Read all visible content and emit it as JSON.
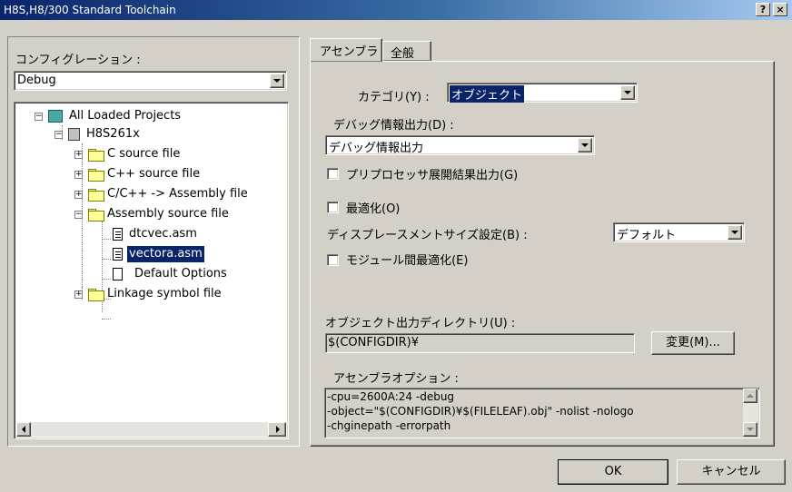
{
  "window": {
    "title": "H8S,H8/300 Standard Toolchain",
    "help_btn": "?",
    "close_btn": "×"
  },
  "left": {
    "config_label": "コンフィグレーション :",
    "config_value": "Debug",
    "tree": [
      {
        "label": "All Loaded Projects",
        "icon": "project-group-icon",
        "expander": "−"
      },
      {
        "label": "H8S261x",
        "icon": "project-icon",
        "expander": "−"
      },
      {
        "label": "C source file",
        "icon": "folder-icon",
        "expander": "+"
      },
      {
        "label": "C++ source file",
        "icon": "folder-icon",
        "expander": "+"
      },
      {
        "label": "C/C++ -> Assembly file",
        "icon": "folder-icon",
        "expander": "+"
      },
      {
        "label": "Assembly source file",
        "icon": "folder-open-icon",
        "expander": "−"
      },
      {
        "label": "dtcvec.asm",
        "icon": "document-icon"
      },
      {
        "label": "vectora.asm",
        "icon": "document-icon",
        "selected": true
      },
      {
        "label": "Default Options",
        "icon": "blank-document-icon"
      },
      {
        "label": "Linkage symbol file",
        "icon": "folder-icon",
        "expander": "+"
      }
    ]
  },
  "tabs": [
    {
      "label": "アセンブラ",
      "active": true
    },
    {
      "label": "全般",
      "active": false
    }
  ],
  "assembler": {
    "category_label": "カテゴリ(Y) :",
    "category_value": "オブジェクト",
    "debug_label": "デバッグ情報出力(D) :",
    "debug_value": "デバッグ情報出力",
    "preprocessor_label": "プリプロセッサ展開結果出力(G)",
    "optimize_label": "最適化(O)",
    "displacement_label": "ディスプレースメントサイズ設定(B) :",
    "displacement_value": "デフォルト",
    "intermodule_label": "モジュール間最適化(E)",
    "outdir_label": "オブジェクト出力ディレクトリ(U) :",
    "outdir_value": "$(CONFIGDIR)¥",
    "change_button": "変更(M)...",
    "options_label": "アセンブラオプション :",
    "options_lines": [
      "-cpu=2600A:24 -debug",
      "-object=\"$(CONFIGDIR)¥$(FILELEAF).obj\" -nolist -nologo",
      "-chginepath -errorpath"
    ]
  },
  "footer": {
    "ok": "OK",
    "cancel": "キャンセル"
  },
  "colors": {
    "face": "#d4d0c8",
    "selection": "#0a246a",
    "title_start": "#0a246a",
    "title_end": "#a6caf0"
  }
}
